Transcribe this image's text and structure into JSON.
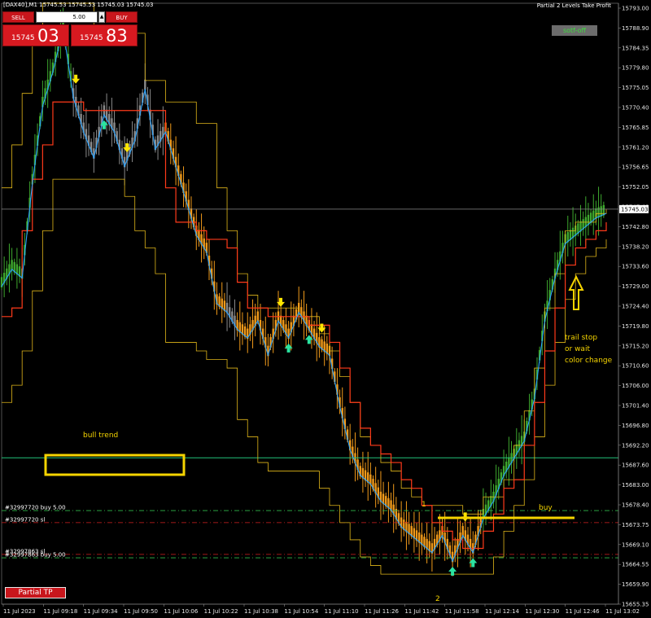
{
  "header": {
    "symbol_line": "[DAX40],M1  15745.53 15745.53 15745.03 15745.03",
    "ea_title": "Partial 2 Levels Take Profit"
  },
  "trade_panel": {
    "sell_label": "SELL",
    "buy_label": "BUY",
    "lot_value": "5.00",
    "sell_price_small": "15745",
    "sell_price_big": "03",
    "buy_price_small": "15745",
    "buy_price_big": "83"
  },
  "buttons": {
    "sotf": "sotf-off",
    "partial_tp": "Partial TP"
  },
  "chart_data": {
    "type": "candlestick",
    "symbol": "DAX40",
    "timeframe": "M1",
    "ylim": [
      15653.0,
      15793.0
    ],
    "current_price": 15745.03,
    "current_price_label": "15745.03",
    "y_ticks": [
      "15793.00",
      "15788.90",
      "15784.35",
      "15779.80",
      "15775.05",
      "15770.40",
      "15765.85",
      "15761.20",
      "15756.65",
      "15752.05",
      "15747.40",
      "15742.80",
      "15738.20",
      "15733.60",
      "15729.00",
      "15724.40",
      "15719.80",
      "15715.20",
      "15710.60",
      "15706.00",
      "15701.40",
      "15696.80",
      "15692.20",
      "15687.60",
      "15683.00",
      "15678.40",
      "15673.75",
      "15669.10",
      "15664.55",
      "15659.90",
      "15655.35"
    ],
    "x_ticks": [
      "11 Jul 2023",
      "11 Jul 09:18",
      "11 Jul 09:34",
      "11 Jul 09:50",
      "11 Jul 10:06",
      "11 Jul 10:22",
      "11 Jul 10:38",
      "11 Jul 10:54",
      "11 Jul 11:10",
      "11 Jul 11:26",
      "11 Jul 11:42",
      "11 Jul 11:58",
      "11 Jul 12:14",
      "11 Jul 12:30",
      "11 Jul 12:46",
      "11 Jul 13:02"
    ],
    "close_path": [
      15728,
      15732,
      15730,
      15752,
      15770,
      15778,
      15788,
      15772,
      15764,
      15758,
      15768,
      15764,
      15756,
      15762,
      15774,
      15760,
      15764,
      15756,
      15748,
      15740,
      15736,
      15724,
      15722,
      15718,
      15716,
      15720,
      15712,
      15720,
      15716,
      15722,
      15718,
      15714,
      15712,
      15700,
      15690,
      15684,
      15682,
      15678,
      15676,
      15672,
      15670,
      15668,
      15666,
      15670,
      15664,
      15670,
      15666,
      15674,
      15678,
      15684,
      15688,
      15692,
      15702,
      15720,
      15730,
      15738,
      15740,
      15742,
      15744,
      15745.03
    ],
    "color_states": [
      "green",
      "green",
      "green",
      "green",
      "green",
      "green",
      "green",
      "gray",
      "gray",
      "gray",
      "gray",
      "gray",
      "gray",
      "gray",
      "gray",
      "gray",
      "orange",
      "orange",
      "orange",
      "orange",
      "orange",
      "orange",
      "gray",
      "orange",
      "orange",
      "orange",
      "orange",
      "orange",
      "orange",
      "orange",
      "orange",
      "orange",
      "orange",
      "orange",
      "orange",
      "orange",
      "orange",
      "orange",
      "orange",
      "orange",
      "orange",
      "orange",
      "orange",
      "orange",
      "orange",
      "orange",
      "orange",
      "green",
      "green",
      "green",
      "green",
      "green",
      "green",
      "green",
      "green",
      "green",
      "green",
      "green",
      "green",
      "green"
    ],
    "red_line": [
      15720,
      15722,
      15740,
      15752,
      15760,
      15770,
      15770,
      15770,
      15768,
      15768,
      15768,
      15768,
      15768,
      15768,
      15768,
      15768,
      15750,
      15742,
      15742,
      15740,
      15738,
      15738,
      15736,
      15728,
      15722,
      15722,
      15720,
      15720,
      15720,
      15720,
      15718,
      15718,
      15714,
      15708,
      15700,
      15694,
      15690,
      15688,
      15686,
      15682,
      15680,
      15676,
      15672,
      15670,
      15668,
      15666,
      15666,
      15670,
      15674,
      15680,
      15682,
      15690,
      15700,
      15712,
      15722,
      15732,
      15736,
      15738,
      15740,
      15742
    ],
    "yellow_upper": [
      15750,
      15760,
      15772,
      15786,
      15793,
      15793,
      15793,
      15793,
      15793,
      15786,
      15786,
      15786,
      15786,
      15786,
      15775,
      15775,
      15770,
      15770,
      15770,
      15765,
      15765,
      15750,
      15740,
      15730,
      15725,
      15722,
      15722,
      15722,
      15722,
      15720,
      15720,
      15716,
      15712,
      15706,
      15700,
      15692,
      15690,
      15686,
      15684,
      15680,
      15678,
      15676,
      15676,
      15676,
      15676,
      15674,
      15674,
      15678,
      15678,
      15682,
      15690,
      15698,
      15708,
      15722,
      15730,
      15740,
      15742,
      15742,
      15744,
      15745
    ],
    "yellow_lower": [
      15700,
      15704,
      15712,
      15726,
      15740,
      15752,
      15752,
      15752,
      15752,
      15752,
      15752,
      15752,
      15748,
      15740,
      15736,
      15730,
      15714,
      15714,
      15714,
      15712,
      15710,
      15710,
      15708,
      15696,
      15692,
      15686,
      15684,
      15684,
      15684,
      15684,
      15684,
      15680,
      15676,
      15672,
      15668,
      15664,
      15662,
      15660,
      15660,
      15660,
      15660,
      15660,
      15660,
      15660,
      15660,
      15660,
      15660,
      15660,
      15664,
      15670,
      15676,
      15682,
      15692,
      15704,
      15714,
      15724,
      15730,
      15734,
      15736,
      15738
    ],
    "trade_lines": [
      {
        "label": "#32997720 buy 5.00",
        "price": 15674.8,
        "color": "#2fb84a"
      },
      {
        "label": "#32997720 sl",
        "price": 15672.0,
        "color": "#d42020"
      },
      {
        "label": "#32997863 sl",
        "price": 15664.6,
        "color": "#d42020"
      },
      {
        "label": "#32997863 buy 5.00",
        "price": 15663.8,
        "color": "#2fb84a"
      }
    ],
    "level_line_price": 15687.1,
    "annotations": {
      "bull_trend": "bull trend",
      "trail_stop_1": "trail stop",
      "trail_stop_2": "or wait",
      "trail_stop_3": "color change",
      "buy": "buy",
      "marker_1": "1",
      "marker_2": "2"
    },
    "up_arrow_indices": [
      10,
      28,
      30,
      44,
      46
    ],
    "down_arrow_indices": [
      7,
      12,
      27,
      31,
      45
    ]
  },
  "colors": {
    "green_bar": "#3ea82e",
    "orange_bar": "#f09a1a",
    "gray_bar": "#8a8a8a",
    "blue_line": "#2aa4ff",
    "red_line": "#ff3a1a",
    "yellow_line": "#e0b61a",
    "level_line": "#23c27a",
    "annotation_yellow": "#f5d400"
  }
}
